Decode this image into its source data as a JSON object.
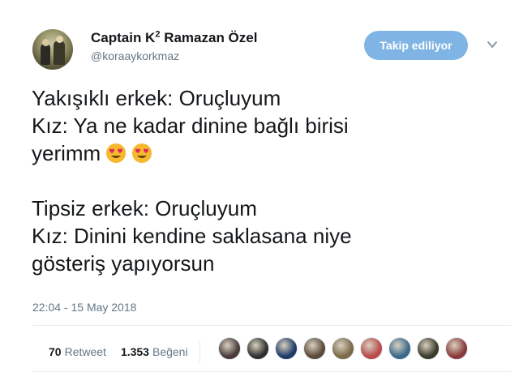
{
  "author": {
    "name": "Captain K",
    "name_sup": "2",
    "name_rest": " Ramazan Özel",
    "handle": "@koraaykorkmaz"
  },
  "follow_button": {
    "label": "Takip ediliyor"
  },
  "tweet": {
    "lines": [
      "Yakışıklı erkek: Oruçluyum",
      "Kız: Ya ne kadar dinine bağlı birisi",
      "yerimm",
      "",
      "Tipsiz erkek: Oruçluyum",
      "Kız: Dinini kendine saklasana niye",
      "gösteriş yapıyorsun"
    ],
    "emojis": [
      "heart-eyes-emoji",
      "heart-eyes-emoji"
    ]
  },
  "timestamp": "22:04 - 15 May 2018",
  "stats": {
    "retweets_count": "70",
    "retweets_label": "Retweet",
    "likes_count": "1.353",
    "likes_label": "Beğeni"
  },
  "likers": [
    {
      "color": "#4a3b3b"
    },
    {
      "color": "#2f2f2f"
    },
    {
      "color": "#1f3a66"
    },
    {
      "color": "#5a4a3a"
    },
    {
      "color": "#7a6a4a"
    },
    {
      "color": "#b84a4a"
    },
    {
      "color": "#3a6a8a"
    },
    {
      "color": "#3b3b2b"
    },
    {
      "color": "#8a3a3a"
    }
  ]
}
